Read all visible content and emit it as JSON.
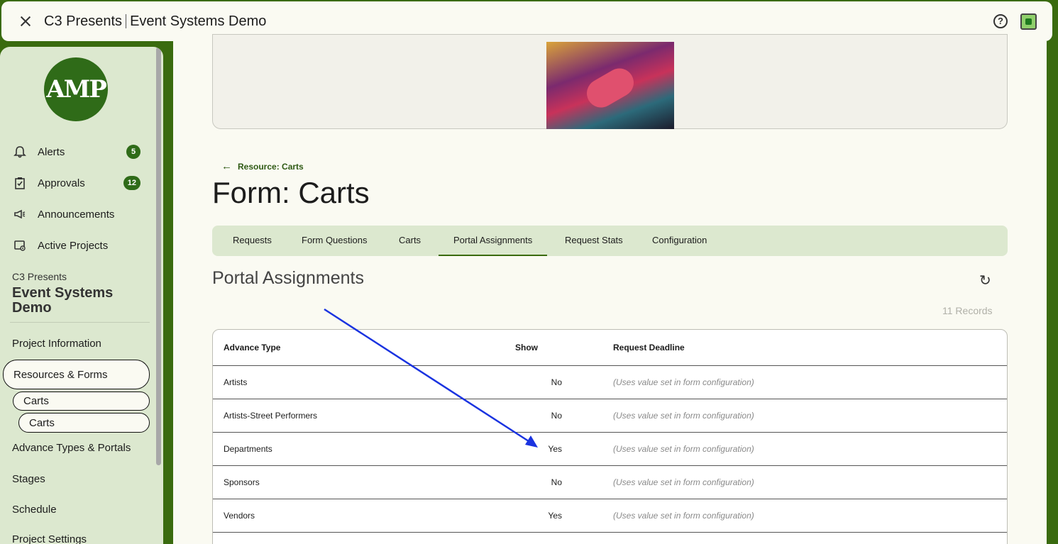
{
  "topbar": {
    "org": "C3 Presents",
    "project": "Event Systems Demo",
    "help_icon": "?"
  },
  "sidebar": {
    "logo_text": "AMP",
    "nav": [
      {
        "label": "Alerts",
        "icon": "bell-icon",
        "badge": "5"
      },
      {
        "label": "Approvals",
        "icon": "clipboard-check-icon",
        "badge": "12"
      },
      {
        "label": "Announcements",
        "icon": "megaphone-icon"
      },
      {
        "label": "Active Projects",
        "icon": "folder-view-icon"
      }
    ],
    "project_org": "C3 Presents",
    "project_name": "Event Systems Demo",
    "links": {
      "project_information": "Project Information",
      "resources_forms": "Resources & Forms",
      "carts_1": "Carts",
      "carts_2": "Carts",
      "advance_types": "Advance Types & Portals",
      "stages": "Stages",
      "schedule": "Schedule",
      "project_settings": "Project Settings"
    }
  },
  "main": {
    "back_link": "Resource: Carts",
    "page_title": "Form: Carts",
    "tabs": [
      "Requests",
      "Form Questions",
      "Carts",
      "Portal Assignments",
      "Request Stats",
      "Configuration"
    ],
    "active_tab": "Portal Assignments",
    "section_title": "Portal Assignments",
    "records": "11 Records",
    "table": {
      "headers": [
        "Advance Type",
        "Show",
        "Request Deadline"
      ],
      "rows": [
        {
          "type": "Artists",
          "show": "No",
          "deadline": "(Uses value set in form configuration)"
        },
        {
          "type": "Artists-Street Performers",
          "show": "No",
          "deadline": "(Uses value set in form configuration)"
        },
        {
          "type": "Departments",
          "show": "Yes",
          "deadline": "(Uses value set in form configuration)"
        },
        {
          "type": "Sponsors",
          "show": "No",
          "deadline": "(Uses value set in form configuration)"
        },
        {
          "type": "Vendors",
          "show": "Yes",
          "deadline": "(Uses value set in form configuration)"
        }
      ]
    }
  },
  "colors": {
    "accent": "#3a6b0f",
    "sidebar_bg": "#dce8cf",
    "annotation_arrow": "#1a33e0"
  }
}
